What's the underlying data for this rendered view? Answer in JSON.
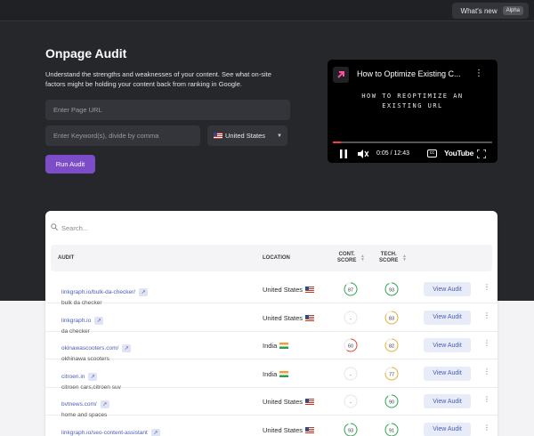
{
  "header": {
    "whats_new": "What's new",
    "alpha_badge": "Alpha"
  },
  "page": {
    "title": "Onpage Audit",
    "description": "Understand the strengths and weaknesses of your content. See what on-site factors might be holding your content back from ranking in Google."
  },
  "form": {
    "url_placeholder": "Enter Page URL",
    "keyword_placeholder": "Enter Keyword(s), divide by comma",
    "location_value": "United States",
    "run_button": "Run Audit"
  },
  "video": {
    "title": "How to Optimize Existing C...",
    "overlay_line1": "HOW TO REOPTIMIZE AN",
    "overlay_line2": "EXISTING URL",
    "time": "0:05 / 12:43",
    "brand": "YouTube",
    "progress": 0.05
  },
  "table": {
    "search_placeholder": "Search...",
    "headers": {
      "audit": "AUDIT",
      "location": "LOCATION",
      "cont_score_1": "CONT.",
      "cont_score_2": "SCORE",
      "tech_score_1": "TECH.",
      "tech_score_2": "SCORE"
    },
    "view_label": "View Audit",
    "rows": [
      {
        "url": "linkgraph.io/bulk-da-checker/",
        "keyword": "bulk da checker",
        "location": "United States",
        "flag": "us",
        "cont": "87",
        "tech": "93"
      },
      {
        "url": "linkgraph.io",
        "keyword": "da checker",
        "location": "United States",
        "flag": "us",
        "cont": "-",
        "tech": "83"
      },
      {
        "url": "okinawascooters.com/",
        "keyword": "okhinawa scooters",
        "location": "India",
        "flag": "in",
        "cont": "60",
        "tech": "82"
      },
      {
        "url": "citroen.in",
        "keyword": "citroen cars,citroen suv",
        "location": "India",
        "flag": "in",
        "cont": "-",
        "tech": "77"
      },
      {
        "url": "bvtnews.com/",
        "keyword": "home and spaces",
        "location": "United States",
        "flag": "us",
        "cont": "-",
        "tech": "90"
      },
      {
        "url": "linkgraph.io/seo-content-assistant",
        "keyword": "seo content assistant",
        "location": "United States",
        "flag": "us",
        "cont": "93",
        "tech": "91"
      }
    ]
  },
  "colors": {
    "accent": "#7c4cc9",
    "good": "#2fa84f",
    "ok": "#e2b23a",
    "poor": "#e0453a",
    "link": "#4a5db8"
  }
}
